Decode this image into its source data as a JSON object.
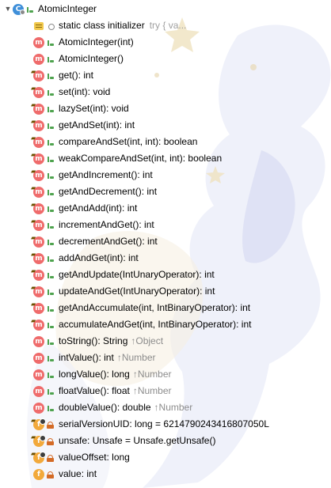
{
  "colors": {
    "method_icon": "#ef6b6b",
    "field_icon": "#f2a93b",
    "class_icon": "#3f8fd9",
    "text": "#000000",
    "hint_text": "#a0a0a0"
  },
  "root": {
    "icon": "class-icon",
    "icon_letter": "C",
    "label": "AtomicInteger"
  },
  "members": [
    {
      "icon": "initializer-icon",
      "glyph": "",
      "visibility": "package",
      "label": "static class initializer",
      "hint": "try {          va..."
    },
    {
      "icon": "method-icon",
      "glyph": "m",
      "visibility": "public",
      "label": "AtomicInteger(int)"
    },
    {
      "icon": "method-icon",
      "glyph": "m",
      "visibility": "public",
      "label": "AtomicInteger()"
    },
    {
      "icon": "method-icon",
      "glyph": "m",
      "visibility": "public",
      "pinned": true,
      "label": "get(): int"
    },
    {
      "icon": "method-icon",
      "glyph": "m",
      "visibility": "public",
      "pinned": true,
      "label": "set(int): void"
    },
    {
      "icon": "method-icon",
      "glyph": "m",
      "visibility": "public",
      "pinned": true,
      "label": "lazySet(int): void"
    },
    {
      "icon": "method-icon",
      "glyph": "m",
      "visibility": "public",
      "pinned": true,
      "label": "getAndSet(int): int"
    },
    {
      "icon": "method-icon",
      "glyph": "m",
      "visibility": "public",
      "pinned": true,
      "label": "compareAndSet(int, int): boolean"
    },
    {
      "icon": "method-icon",
      "glyph": "m",
      "visibility": "public",
      "pinned": true,
      "label": "weakCompareAndSet(int, int): boolean"
    },
    {
      "icon": "method-icon",
      "glyph": "m",
      "visibility": "public",
      "pinned": true,
      "label": "getAndIncrement(): int"
    },
    {
      "icon": "method-icon",
      "glyph": "m",
      "visibility": "public",
      "pinned": true,
      "label": "getAndDecrement(): int"
    },
    {
      "icon": "method-icon",
      "glyph": "m",
      "visibility": "public",
      "pinned": true,
      "label": "getAndAdd(int): int"
    },
    {
      "icon": "method-icon",
      "glyph": "m",
      "visibility": "public",
      "pinned": true,
      "label": "incrementAndGet(): int"
    },
    {
      "icon": "method-icon",
      "glyph": "m",
      "visibility": "public",
      "pinned": true,
      "label": "decrementAndGet(): int"
    },
    {
      "icon": "method-icon",
      "glyph": "m",
      "visibility": "public",
      "pinned": true,
      "label": "addAndGet(int): int"
    },
    {
      "icon": "method-icon",
      "glyph": "m",
      "visibility": "public",
      "pinned": true,
      "label": "getAndUpdate(IntUnaryOperator): int"
    },
    {
      "icon": "method-icon",
      "glyph": "m",
      "visibility": "public",
      "pinned": true,
      "label": "updateAndGet(IntUnaryOperator): int"
    },
    {
      "icon": "method-icon",
      "glyph": "m",
      "visibility": "public",
      "pinned": true,
      "label": "getAndAccumulate(int, IntBinaryOperator): int"
    },
    {
      "icon": "method-icon",
      "glyph": "m",
      "visibility": "public",
      "pinned": true,
      "label": "accumulateAndGet(int, IntBinaryOperator): int"
    },
    {
      "icon": "method-icon",
      "glyph": "m",
      "visibility": "public",
      "label": "toString(): String",
      "super": "↑Object"
    },
    {
      "icon": "method-icon",
      "glyph": "m",
      "visibility": "public",
      "label": "intValue(): int",
      "super": "↑Number"
    },
    {
      "icon": "method-icon",
      "glyph": "m",
      "visibility": "public",
      "label": "longValue(): long",
      "super": "↑Number"
    },
    {
      "icon": "method-icon",
      "glyph": "m",
      "visibility": "public",
      "label": "floatValue(): float",
      "super": "↑Number"
    },
    {
      "icon": "method-icon",
      "glyph": "m",
      "visibility": "public",
      "label": "doubleValue(): double",
      "super": "↑Number"
    },
    {
      "icon": "field-icon",
      "glyph": "f",
      "visibility": "private",
      "pinned": true,
      "static": true,
      "label": "serialVersionUID: long = 6214790243416807050L"
    },
    {
      "icon": "field-icon",
      "glyph": "f",
      "visibility": "private",
      "pinned": true,
      "static": true,
      "label": "unsafe: Unsafe = Unsafe.getUnsafe()"
    },
    {
      "icon": "field-icon",
      "glyph": "f",
      "visibility": "private",
      "pinned": true,
      "static": true,
      "label": "valueOffset: long"
    },
    {
      "icon": "field-icon",
      "glyph": "f",
      "visibility": "private",
      "label": "value: int"
    }
  ]
}
